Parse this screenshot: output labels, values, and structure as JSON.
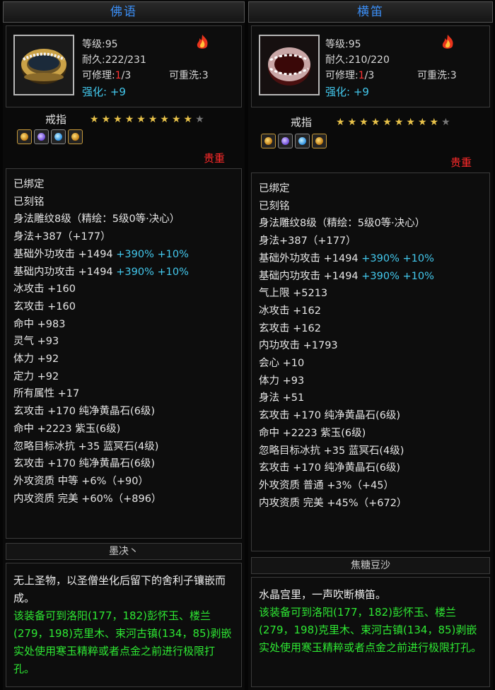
{
  "left": {
    "title": "佛语",
    "level": "等级:95",
    "durability": "耐久:222/231",
    "repair_prefix": "可修理:",
    "repair_count": "1",
    "repair_total": "/3",
    "rewash": "可重洗:3",
    "enhance_label": "强化:",
    "enhance_value": "+9",
    "type": "戒指",
    "stars_on": 9,
    "stars_total": 10,
    "gems": [
      "gold",
      "purple",
      "sblue",
      "gold"
    ],
    "rarity": "贵重",
    "bound": "已绑定",
    "engraved": "已刻铭",
    "line1": "身法雕纹8级（精绘：5级0等·决心）",
    "line2": "身法+387（+177）",
    "atk_ext_a": "基础外功攻击 +1494 ",
    "atk_ext_b": "+390% +10%",
    "atk_int_a": "基础内功攻击 +1494 ",
    "atk_int_b": "+390% +10%",
    "stats": [
      "冰攻击 +160",
      "玄攻击 +160",
      "命中 +983",
      "灵气 +93",
      "体力 +92",
      "定力 +92",
      "所有属性 +17",
      "玄攻击 +170 纯净黄晶石(6级)",
      "命中 +2223 紫玉(6级)",
      "忽略目标冰抗 +35 蓝冥石(4级)",
      "玄攻击 +170 纯净黄晶石(6级)"
    ],
    "qual1": "外攻资质  中等 +6%（+90）",
    "qual2": "内攻资质  完美 +60%（+896）",
    "subtitle": "墨决丶",
    "desc_white": "无上圣物，以圣僧坐化后留下的舍利子镶嵌而成。",
    "desc_green": "该装备可到洛阳(177，182)彭怀玉、楼兰(279，198)克里木、束河古镇(134，85)剥嵌实处使用寒玉精粹或者点金之前进行极限打孔。"
  },
  "right": {
    "title": "横笛",
    "level": "等级:95",
    "durability": "耐久:210/220",
    "repair_prefix": "可修理:",
    "repair_count": "1",
    "repair_total": "/3",
    "rewash": "可重洗:3",
    "enhance_label": "强化:",
    "enhance_value": "+9",
    "type": "戒指",
    "stars_on": 9,
    "stars_total": 10,
    "gems": [
      "gold",
      "purple",
      "sblue",
      "gold"
    ],
    "rarity": "贵重",
    "bound": "已绑定",
    "engraved": "已刻铭",
    "line1": "身法雕纹8级（精绘：5级0等·决心）",
    "line2": "身法+387（+177）",
    "atk_ext_a": "基础外功攻击 +1494 ",
    "atk_ext_b": "+390% +10%",
    "atk_int_a": "基础内功攻击 +1494 ",
    "atk_int_b": "+390% +10%",
    "stats": [
      "气上限 +5213",
      "冰攻击 +162",
      "玄攻击 +162",
      "内功攻击 +1793",
      "会心 +10",
      "体力 +93",
      "身法 +51",
      "玄攻击 +170 纯净黄晶石(6级)",
      "命中 +2223 紫玉(6级)",
      "忽略目标冰抗 +35 蓝冥石(4级)",
      "玄攻击 +170 纯净黄晶石(6级)"
    ],
    "qual1": "外攻资质  普通 +3%（+45）",
    "qual2": "内攻资质  完美 +45%（+672）",
    "subtitle": "焦糖豆沙",
    "desc_white": "水晶宫里，一声吹断横笛。",
    "desc_green": "该装备可到洛阳(177，182)彭怀玉、楼兰(279，198)克里木、束河古镇(134，85)剥嵌实处使用寒玉精粹或者点金之前进行极限打孔。"
  }
}
